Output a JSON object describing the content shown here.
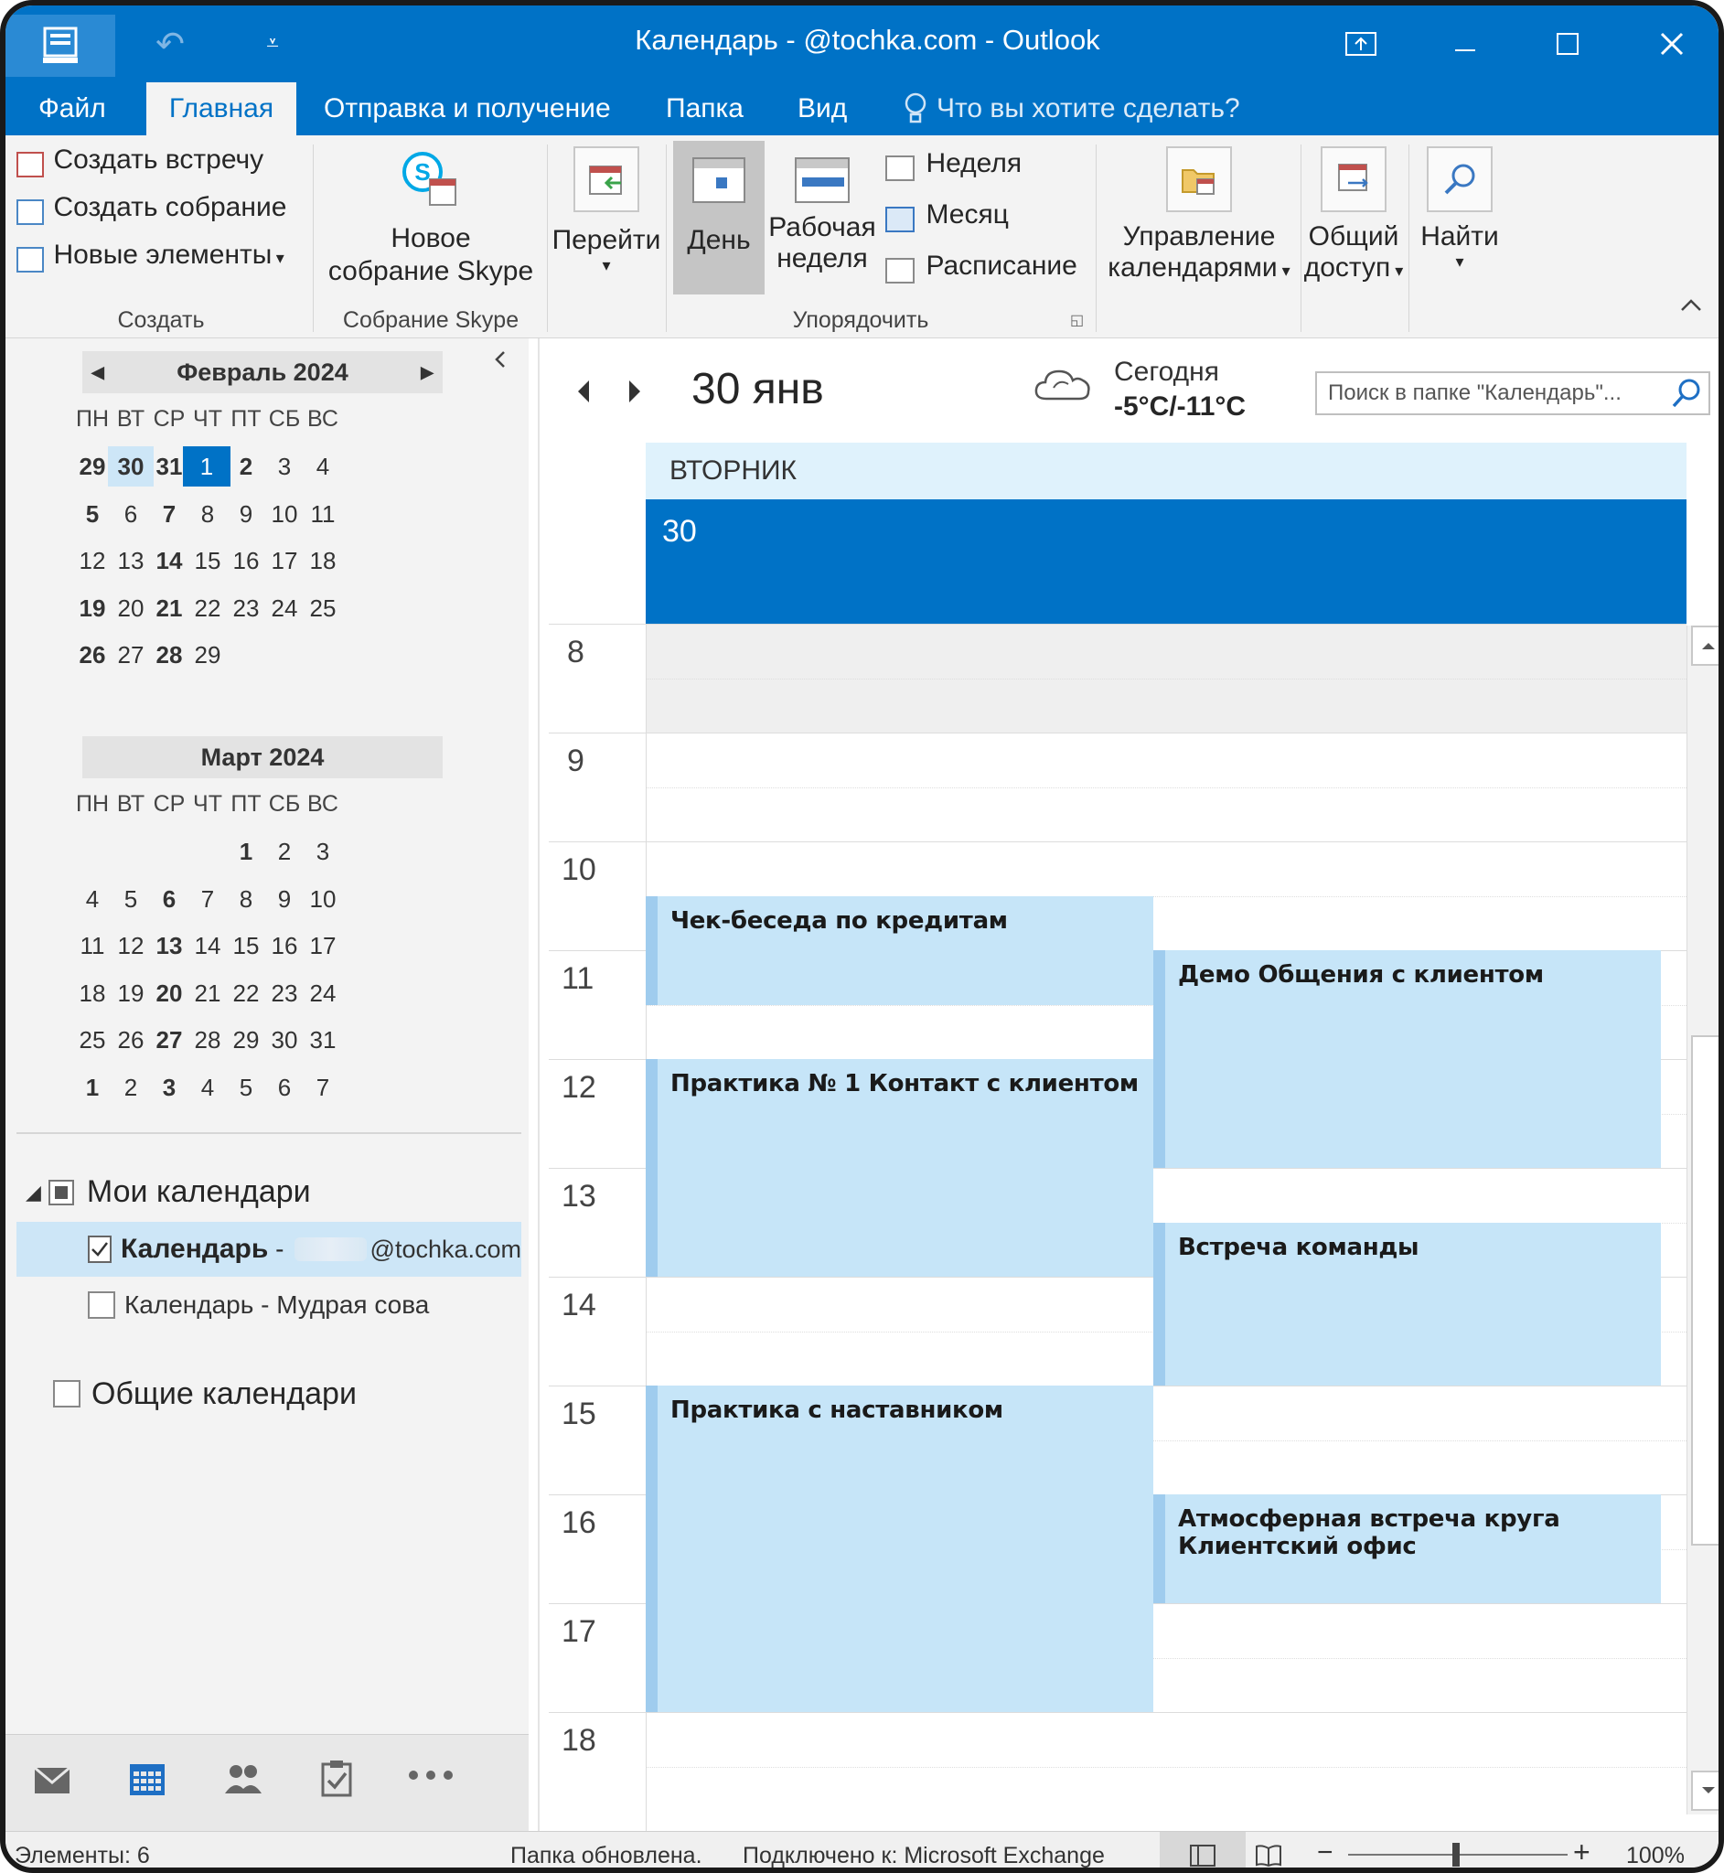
{
  "window": {
    "title": "Календарь -             @tochka.com - Outlook",
    "qat_undo": "↶",
    "qat_customize": "⩡"
  },
  "tabs": [
    "Файл",
    "Главная",
    "Отправка и получение",
    "Папка",
    "Вид"
  ],
  "tell_me": "Что вы хотите сделать?",
  "ribbon": {
    "create": {
      "new_appointment": "Создать встречу",
      "new_meeting": "Создать собрание",
      "new_items": "Новые элементы",
      "label": "Создать"
    },
    "skype": {
      "line1": "Новое",
      "line2": "собрание Skype",
      "label": "Собрание Skype"
    },
    "goto": {
      "label": "Перейти"
    },
    "arrange": {
      "day": "День",
      "workweek_1": "Рабочая",
      "workweek_2": "неделя",
      "week": "Неделя",
      "month": "Месяц",
      "schedule": "Расписание",
      "label": "Упорядочить"
    },
    "manage": {
      "line1": "Управление",
      "line2": "календарями"
    },
    "share": {
      "line1": "Общий",
      "line2": "доступ"
    },
    "find": {
      "line1": "Найти"
    }
  },
  "mini_calendars": [
    {
      "title": "Февраль 2024",
      "dow": [
        "ПН",
        "ВТ",
        "СР",
        "ЧТ",
        "ПТ",
        "СБ",
        "ВС"
      ],
      "weeks": [
        [
          {
            "d": "29",
            "b": true
          },
          {
            "d": "30",
            "b": true,
            "sel": true
          },
          {
            "d": "31",
            "b": true
          },
          {
            "d": "1",
            "today": true
          },
          {
            "d": "2",
            "b": true
          },
          {
            "d": "3"
          },
          {
            "d": "4"
          }
        ],
        [
          {
            "d": "5",
            "b": true
          },
          {
            "d": "6"
          },
          {
            "d": "7",
            "b": true
          },
          {
            "d": "8"
          },
          {
            "d": "9"
          },
          {
            "d": "10"
          },
          {
            "d": "11"
          }
        ],
        [
          {
            "d": "12"
          },
          {
            "d": "13"
          },
          {
            "d": "14",
            "b": true
          },
          {
            "d": "15"
          },
          {
            "d": "16"
          },
          {
            "d": "17"
          },
          {
            "d": "18"
          }
        ],
        [
          {
            "d": "19",
            "b": true
          },
          {
            "d": "20"
          },
          {
            "d": "21",
            "b": true
          },
          {
            "d": "22"
          },
          {
            "d": "23"
          },
          {
            "d": "24"
          },
          {
            "d": "25"
          }
        ],
        [
          {
            "d": "26",
            "b": true
          },
          {
            "d": "27"
          },
          {
            "d": "28",
            "b": true
          },
          {
            "d": "29"
          },
          {
            "d": ""
          },
          {
            "d": ""
          },
          {
            "d": ""
          }
        ]
      ]
    },
    {
      "title": "Март 2024",
      "dow": [
        "ПН",
        "ВТ",
        "СР",
        "ЧТ",
        "ПТ",
        "СБ",
        "ВС"
      ],
      "weeks": [
        [
          {
            "d": ""
          },
          {
            "d": ""
          },
          {
            "d": ""
          },
          {
            "d": ""
          },
          {
            "d": "1",
            "b": true
          },
          {
            "d": "2"
          },
          {
            "d": "3"
          }
        ],
        [
          {
            "d": "4"
          },
          {
            "d": "5"
          },
          {
            "d": "6",
            "b": true
          },
          {
            "d": "7"
          },
          {
            "d": "8"
          },
          {
            "d": "9"
          },
          {
            "d": "10"
          }
        ],
        [
          {
            "d": "11"
          },
          {
            "d": "12"
          },
          {
            "d": "13",
            "b": true
          },
          {
            "d": "14"
          },
          {
            "d": "15"
          },
          {
            "d": "16"
          },
          {
            "d": "17"
          }
        ],
        [
          {
            "d": "18"
          },
          {
            "d": "19"
          },
          {
            "d": "20",
            "b": true
          },
          {
            "d": "21"
          },
          {
            "d": "22"
          },
          {
            "d": "23"
          },
          {
            "d": "24"
          }
        ],
        [
          {
            "d": "25"
          },
          {
            "d": "26"
          },
          {
            "d": "27",
            "b": true
          },
          {
            "d": "28"
          },
          {
            "d": "29"
          },
          {
            "d": "30"
          },
          {
            "d": "31"
          }
        ],
        [
          {
            "d": "1",
            "b": true
          },
          {
            "d": "2"
          },
          {
            "d": "3",
            "b": true
          },
          {
            "d": "4"
          },
          {
            "d": "5"
          },
          {
            "d": "6"
          },
          {
            "d": "7"
          }
        ]
      ]
    }
  ],
  "folders": {
    "my_calendars": "Мои календари",
    "cal1_name": "Календарь",
    "cal1_sep": " - ",
    "cal1_account": "@tochka.com",
    "cal2": "Календарь - Мудрая сова",
    "shared": "Общие календари"
  },
  "day_view": {
    "date_title": "30 янв",
    "weather_label": "Сегодня",
    "weather_temp": "-5°C/-11°C",
    "search_placeholder": "Поиск в папке \"Календарь\"...",
    "weekday": "ВТОРНИК",
    "day_number": "30",
    "hours": [
      "8",
      "9",
      "10",
      "11",
      "12",
      "13",
      "14",
      "15",
      "16",
      "17",
      "18"
    ]
  },
  "appointments": [
    {
      "title": "Чек-беседа по кредитам",
      "start": "10:30",
      "end": "11:30",
      "column": 1
    },
    {
      "title": "Демо Общения с клиентом",
      "start": "11:00",
      "end": "13:00",
      "column": 2
    },
    {
      "title": "Практика № 1 Контакт с клиентом",
      "start": "12:00",
      "end": "14:00",
      "column": 1
    },
    {
      "title": "Встреча команды",
      "start": "13:30",
      "end": "15:00",
      "column": 2
    },
    {
      "title": "Практика с наставником",
      "start": "15:00",
      "end": "18:00",
      "column": 1
    },
    {
      "title": "Атмосферная встреча круга Клиентский офис",
      "start": "16:00",
      "end": "17:00",
      "column": 2
    }
  ],
  "status": {
    "items": "Элементы: 6",
    "updated": "Папка обновлена.",
    "connected": "Подключено к: Microsoft Exchange",
    "zoom": "100%"
  },
  "colors": {
    "accent": "#0072c6",
    "appointment": "#c6e5f8",
    "appointment_bar": "#9fccee",
    "weekday_band": "#dff2fc"
  }
}
